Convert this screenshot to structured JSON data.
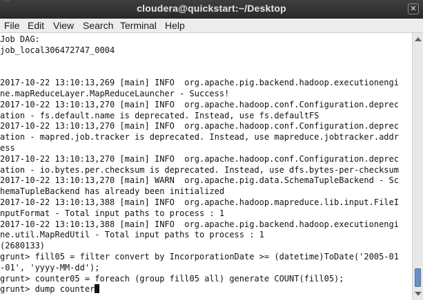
{
  "window": {
    "title": "cloudera@quickstart:~/Desktop",
    "title_partial_above": "...",
    "close_glyph": "✕"
  },
  "menu": {
    "items": [
      "File",
      "Edit",
      "View",
      "Search",
      "Terminal",
      "Help"
    ]
  },
  "terminal": {
    "lines": [
      "Job DAG:",
      "job_local306472747_0004",
      "",
      "",
      "2017-10-22 13:10:13,269 [main] INFO  org.apache.pig.backend.hadoop.executionengi",
      "ne.mapReduceLayer.MapReduceLauncher - Success!",
      "2017-10-22 13:10:13,270 [main] INFO  org.apache.hadoop.conf.Configuration.deprec",
      "ation - fs.default.name is deprecated. Instead, use fs.defaultFS",
      "2017-10-22 13:10:13,270 [main] INFO  org.apache.hadoop.conf.Configuration.deprec",
      "ation - mapred.job.tracker is deprecated. Instead, use mapreduce.jobtracker.addr",
      "ess",
      "2017-10-22 13:10:13,270 [main] INFO  org.apache.hadoop.conf.Configuration.deprec",
      "ation - io.bytes.per.checksum is deprecated. Instead, use dfs.bytes-per-checksum",
      "2017-10-22 13:10:13,270 [main] WARN  org.apache.pig.data.SchemaTupleBackend - Sc",
      "hemaTupleBackend has already been initialized",
      "2017-10-22 13:10:13,388 [main] INFO  org.apache.hadoop.mapreduce.lib.input.FileI",
      "nputFormat - Total input paths to process : 1",
      "2017-10-22 13:10:13,388 [main] INFO  org.apache.pig.backend.hadoop.executionengi",
      "ne.util.MapRedUtil - Total input paths to process : 1",
      "(2680133)",
      "grunt> fill05 = filter convert by IncorporationDate >= (datetime)ToDate('2005-01",
      "-01', 'yyyy-MM-dd');",
      "grunt> counter05 = foreach (group fill05 all) generate COUNT(fill05);"
    ],
    "current_input": "grunt> dump counter"
  },
  "colors": {
    "titlebar": "#2f2f2f",
    "title_text": "#e6e6e6",
    "menubar": "#ededed",
    "terminal_bg": "#ffffff",
    "terminal_fg": "#111111",
    "scroll_thumb": "#6a8fc8"
  }
}
